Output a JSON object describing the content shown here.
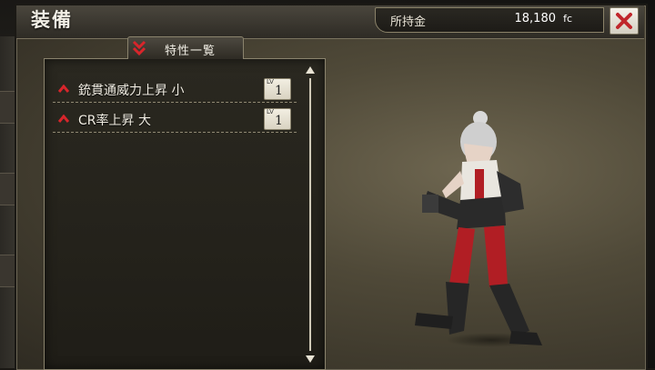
{
  "header": {
    "title": "装備",
    "money_label": "所持金",
    "money_value": "18,180",
    "money_unit": "fc"
  },
  "traits_tab": {
    "label": "特性一覧"
  },
  "traits": [
    {
      "name": "銃貫通威力上昇 小",
      "level_tag": "LV",
      "level": "1"
    },
    {
      "name": "CR率上昇 大",
      "level_tag": "LV",
      "level": "1"
    }
  ],
  "colors": {
    "accent_red": "#c0262b",
    "text_light": "#f3efe4",
    "frame_gold": "#8a836d"
  },
  "icons": {
    "close": "close-x-icon",
    "chevron": "double-chevron-down-icon",
    "arrow": "up-arrow-icon"
  }
}
